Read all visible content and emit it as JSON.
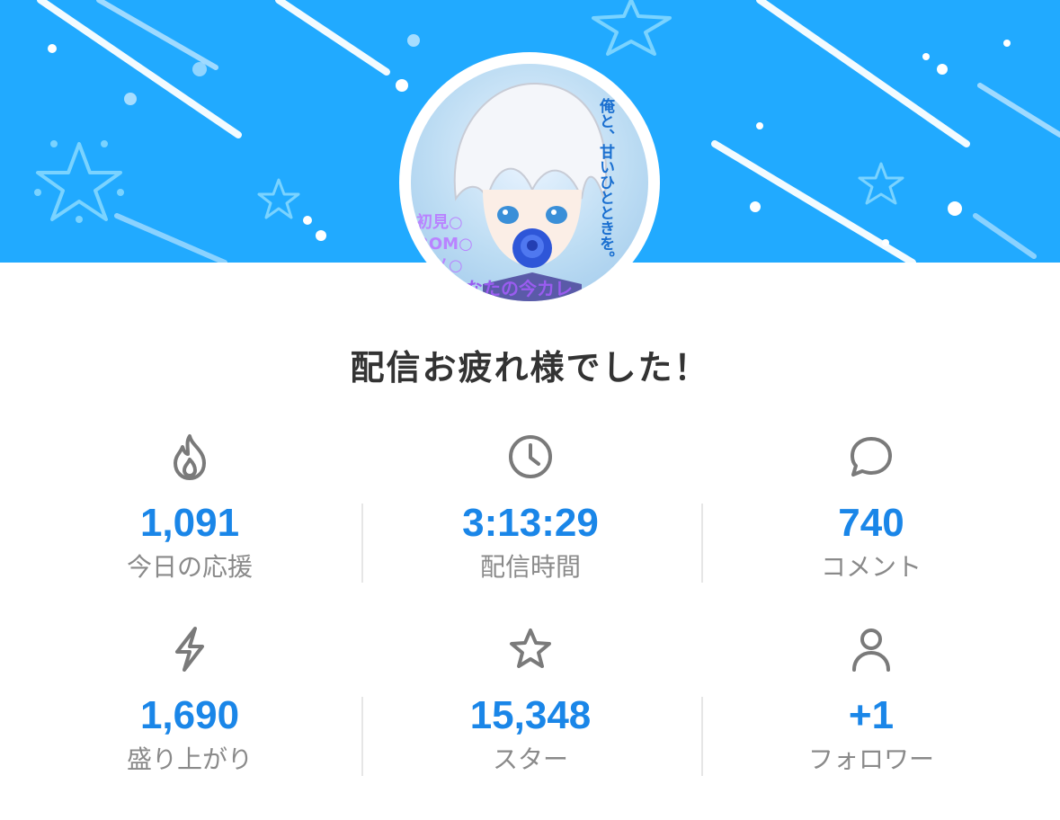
{
  "avatar": {
    "overlay_text_vertical": "俺と、甘いひとときを。",
    "overlay_text_left": [
      "初見○",
      "ROM○",
      "カノ○"
    ],
    "overlay_text_bottom": "あなたの今カレ"
  },
  "headline": "配信お疲れ様でした！",
  "stats": [
    {
      "icon": "flame-icon",
      "value": "1,091",
      "label": "今日の応援"
    },
    {
      "icon": "clock-icon",
      "value": "3:13:29",
      "label": "配信時間"
    },
    {
      "icon": "comment-bubble-icon",
      "value": "740",
      "label": "コメント"
    },
    {
      "icon": "lightning-icon",
      "value": "1,690",
      "label": "盛り上がり"
    },
    {
      "icon": "star-icon",
      "value": "15,348",
      "label": "スター"
    },
    {
      "icon": "person-icon",
      "value": "+1",
      "label": "フォロワー"
    }
  ],
  "colors": {
    "banner": "#21aaff",
    "value": "#1a86e8",
    "label": "#8a8a8a",
    "headline": "#333333",
    "icon": "#7a7a7a"
  }
}
